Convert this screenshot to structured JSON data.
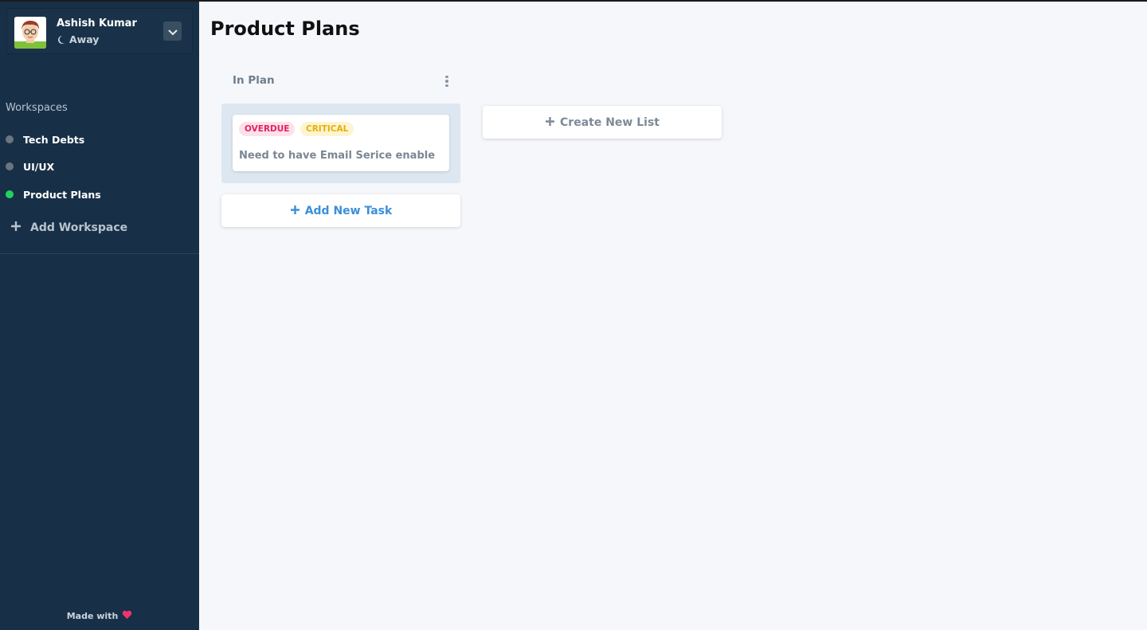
{
  "user": {
    "name": "Ashish Kumar",
    "status": "Away"
  },
  "sidebar": {
    "workspaces_heading": "Workspaces",
    "items": [
      {
        "label": "Tech Debts",
        "dot_color": "#6b7580"
      },
      {
        "label": "UI/UX",
        "dot_color": "#6b7580"
      },
      {
        "label": "Product Plans",
        "dot_color": "#23d160"
      }
    ],
    "add_workspace_label": "Add Workspace",
    "footer_label": "Made with"
  },
  "main": {
    "page_title": "Product Plans",
    "lists": [
      {
        "title": "In Plan",
        "tasks": [
          {
            "tags": [
              "OVERDUE",
              "CRITICAL"
            ],
            "text": "Need to have Email Serice enable"
          }
        ],
        "add_task_label": "Add New Task"
      }
    ],
    "create_list_label": "Create New List"
  },
  "colors": {
    "sidebar_bg": "#183047",
    "accent_blue": "#3a8fd9",
    "active_dot": "#23d160",
    "heart": "#f0356b"
  },
  "icons": {
    "status": "moon-icon",
    "dropdown": "chevron-down-icon",
    "add": "plus-icon",
    "list_menu": "kebab-menu-icon",
    "footer": "heart-icon"
  }
}
